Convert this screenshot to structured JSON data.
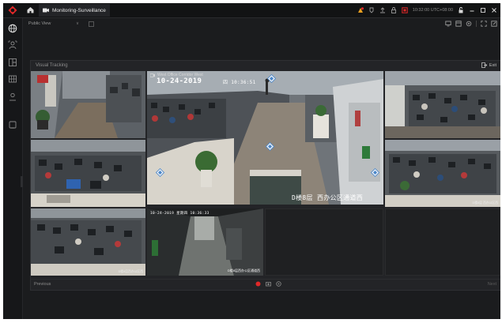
{
  "titlebar": {
    "tab_title": "Monitoring-Surveillance",
    "time": "10:32:00 UTC+08:00"
  },
  "toolbar": {
    "view_label": "Public View",
    "chevron": "∨"
  },
  "panel": {
    "title": "Visual Tracking",
    "exit_label": "Exit",
    "previous_label": "Previous",
    "next_label": "Next"
  },
  "cameras": {
    "main": {
      "name": "West Office Corridor West",
      "osd_date": "10-24-2019",
      "osd_time": "四 10:36:51",
      "caption": "D楼8层 西办公区通道西"
    },
    "bottom_middle": {
      "osd": "10-24-2019 星期四 10:36:33",
      "caption": "D楼8层西办公区通道西"
    },
    "right_bottom": {
      "caption": "D楼8层 西办公区西"
    },
    "left_bottom": {
      "caption": "D楼8层西办公区西"
    }
  },
  "icons": [
    "logo-icon",
    "home-icon",
    "camera-tab-icon",
    "alarm-icon",
    "notification-icon",
    "upload-icon",
    "lock-icon",
    "screen-icon",
    "user-icon",
    "minimize-icon",
    "maximize-icon",
    "close-icon",
    "globe-icon",
    "person-icon",
    "layout-icon",
    "grid-icon",
    "user-circle-icon",
    "search-icon",
    "exit-icon",
    "arrow-up-icon",
    "arrow-left-icon",
    "arrow-right-icon",
    "record-icon",
    "capture-icon",
    "target-icon"
  ],
  "colors": {
    "accent_red": "#e02828",
    "arrow_blue": "#4a86c8",
    "background": "#1b1c1e"
  }
}
